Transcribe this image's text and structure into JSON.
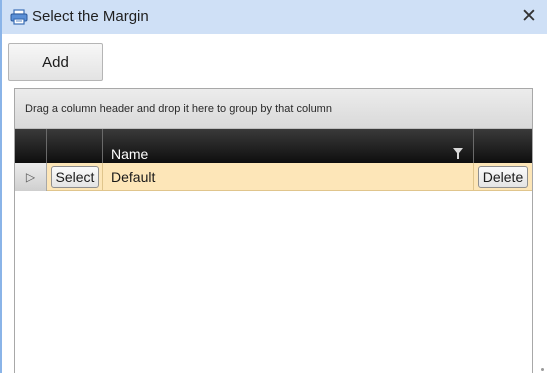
{
  "window": {
    "title": "Select the Margin",
    "close_label": "✕"
  },
  "toolbar": {
    "add_label": "Add"
  },
  "grid": {
    "group_panel_hint": "Drag a column header and drop it here to group by that column",
    "columns": [
      {
        "key": "select",
        "label": ""
      },
      {
        "key": "name",
        "label": "Name"
      },
      {
        "key": "delete",
        "label": ""
      }
    ],
    "rows": [
      {
        "indicator": "▷",
        "select_label": "Select",
        "name": "Default",
        "delete_label": "Delete"
      }
    ]
  },
  "icons": {
    "title": "printer-icon",
    "filter": "filter-icon",
    "row_indicator": "current-row-icon"
  },
  "colors": {
    "titlebar": "#cfe0f6",
    "header": "#1a1a1a",
    "selected_row": "#fde6b8"
  }
}
